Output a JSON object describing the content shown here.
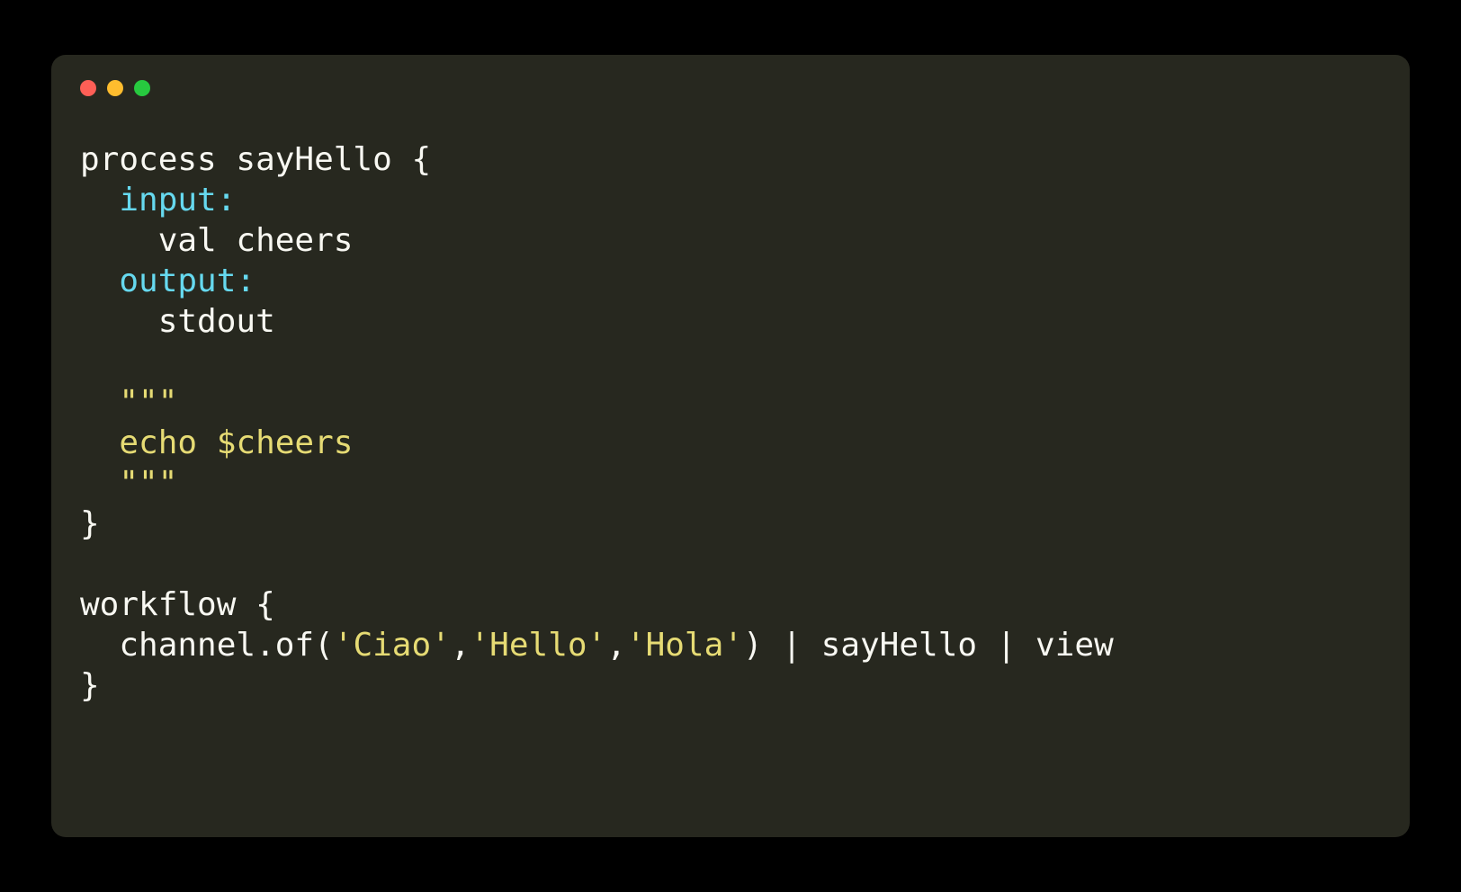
{
  "colors": {
    "background": "#000000",
    "terminal_bg": "#27281f",
    "close": "#ff5f56",
    "minimize": "#ffbd2e",
    "maximize": "#27c93f",
    "default_text": "#f8f8f2",
    "keyword": "#66d9ef",
    "string": "#e6db74"
  },
  "code": {
    "line1": "process sayHello {",
    "line2_indent": "  ",
    "line2_keyword": "input:",
    "line3": "    val cheers",
    "line4_indent": "  ",
    "line4_keyword": "output:",
    "line5": "    stdout",
    "line6": "",
    "line7_indent": "  ",
    "line7_string": "\"\"\"",
    "line8_indent": "  ",
    "line8_string": "echo $cheers",
    "line9_indent": "  ",
    "line9_string": "\"\"\"",
    "line10": "}",
    "line11": "",
    "line12": "workflow {",
    "line13_part1": "  channel.of(",
    "line13_str1": "'Ciao'",
    "line13_comma1": ",",
    "line13_str2": "'Hello'",
    "line13_comma2": ",",
    "line13_str3": "'Hola'",
    "line13_part2": ") | sayHello | view",
    "line14": "}"
  }
}
